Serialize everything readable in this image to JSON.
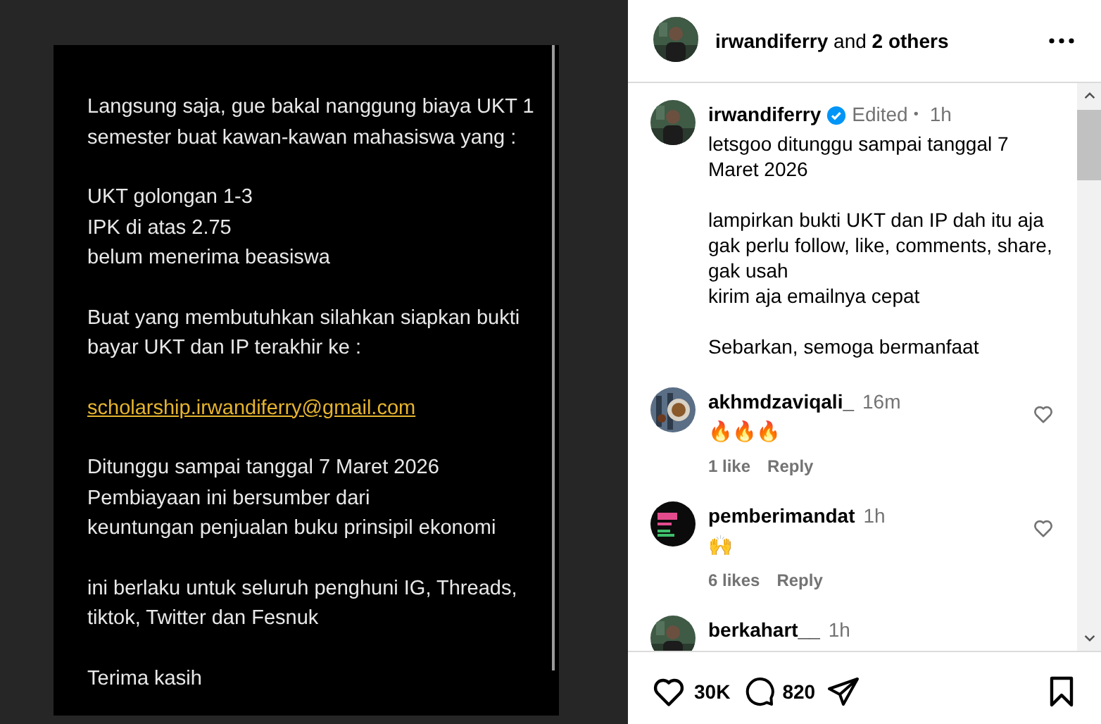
{
  "image": {
    "paragraphs": [
      {
        "kind": "text",
        "lines": [
          "Langsung saja, gue bakal nanggung biaya UKT 1",
          "semester buat kawan-kawan mahasiswa yang :"
        ]
      },
      {
        "kind": "text",
        "lines": [
          "UKT golongan 1-3",
          "IPK di atas 2.75",
          "belum menerima beasiswa"
        ]
      },
      {
        "kind": "text",
        "lines": [
          "Buat yang membutuhkan silahkan siapkan bukti",
          "bayar UKT dan IP terakhir ke :"
        ]
      },
      {
        "kind": "link",
        "lines": [
          "scholarship.irwandiferry@gmail.com"
        ]
      },
      {
        "kind": "text",
        "lines": [
          "Ditunggu sampai tanggal 7 Maret 2026",
          "Pembiayaan ini bersumber dari",
          "keuntungan penjualan buku prinsipil ekonomi"
        ]
      },
      {
        "kind": "text",
        "lines": [
          "ini berlaku untuk seluruh penghuni IG, Threads,",
          "tiktok, Twitter dan Fesnuk"
        ]
      },
      {
        "kind": "text",
        "lines": [
          "Terima kasih"
        ]
      }
    ]
  },
  "header": {
    "authors": "**irwandiferry** and **2 others**"
  },
  "caption": {
    "username": "irwandiferry",
    "verified": true,
    "edited": "Edited",
    "separator": "•",
    "time": "1h",
    "paragraphs": [
      [
        "letsgoo ditunggu sampai tanggal 7",
        "Maret 2026"
      ],
      [
        "lampirkan bukti UKT dan IP dah itu aja",
        "gak perlu follow, like, comments, share,",
        "gak usah",
        "kirim aja emailnya cepat"
      ],
      [
        "Sebarkan, semoga bermanfaat"
      ]
    ]
  },
  "comments": [
    {
      "username": "akhmdzaviqali_",
      "time": "16m",
      "text": "🔥🔥🔥",
      "likes": "1 like",
      "reply": "Reply"
    },
    {
      "username": "pemberimandat",
      "time": "1h",
      "text": "🙌",
      "likes": "6 likes",
      "reply": "Reply"
    },
    {
      "username": "berkahart__",
      "time": "1h"
    }
  ],
  "actions": {
    "likes": "30K",
    "comments": "820"
  }
}
